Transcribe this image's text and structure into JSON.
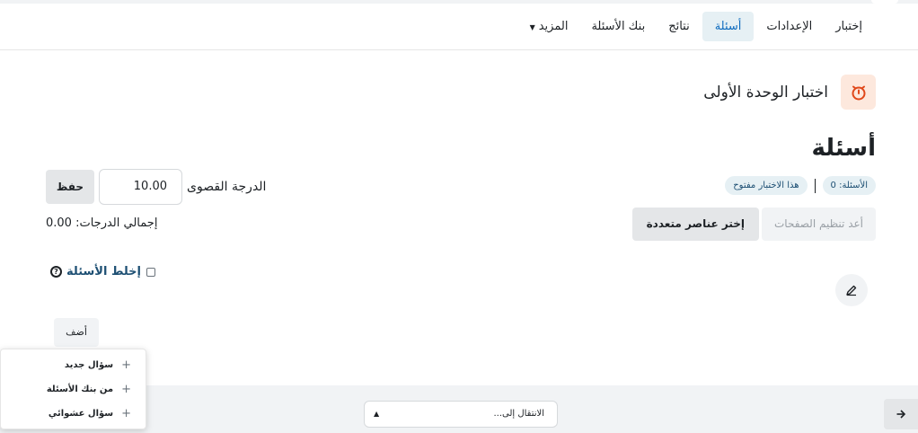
{
  "nav": {
    "tabs": [
      {
        "label": "إختبار"
      },
      {
        "label": "الإعدادات"
      },
      {
        "label": "أسئلة",
        "active": true
      },
      {
        "label": "نتائج"
      },
      {
        "label": "بنك الأسئلة"
      },
      {
        "label": "المزيد",
        "icon": "caret-down-icon"
      }
    ]
  },
  "activity": {
    "title": "اختبار الوحدة الأولى",
    "icon": "quiz-timer-icon",
    "icon_color": "#e0481a"
  },
  "page": {
    "heading": "أسئلة"
  },
  "status": {
    "questions_count": "الأسئلة: 0",
    "quiz_open": "هذا الاختبار مفتوح"
  },
  "actions": {
    "repaginate": "أعد تنظيم الصفحات",
    "select_multiple": "إختر عناصر متعددة"
  },
  "grade": {
    "label": "الدرجة القصوى",
    "value": "10.00",
    "save": "حفظ",
    "total": "إجمالي الدرجات: 0.00"
  },
  "shuffle": {
    "label": "إخلط الأسئلة",
    "checked": false,
    "help_icon": "help-question-icon"
  },
  "edit": {
    "icon": "pencil-icon"
  },
  "add": {
    "label": "أضف"
  },
  "add_menu": {
    "items": [
      {
        "label": "سؤال جديد"
      },
      {
        "label": "من بنك الأسئلة"
      },
      {
        "label": "سؤال عشوائي"
      }
    ]
  },
  "footer": {
    "jump_placeholder": "الانتقال إلى...",
    "next_icon": "arrow-right-icon"
  },
  "colors": {
    "accent": "#0f6cbf",
    "pill_bg": "#e6f0f4",
    "activity_bg": "#fde8dd"
  }
}
